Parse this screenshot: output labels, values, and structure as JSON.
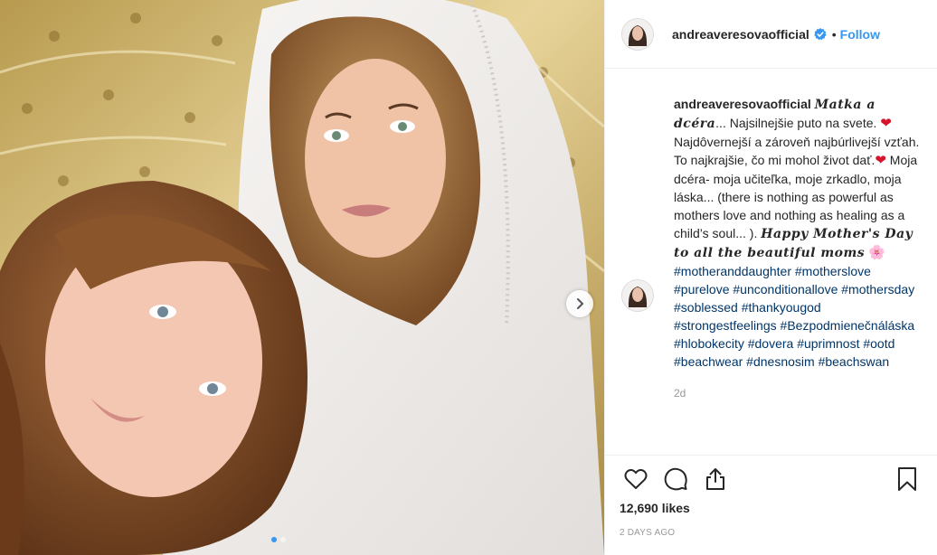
{
  "post": {
    "username": "andreaveresovaofficial",
    "separator": "•",
    "follow_label": "Follow",
    "verified": true,
    "caption_user": "andreaveresovaofficial",
    "caption_script_1": "𝑴𝒂𝒕𝒌𝒂 𝒂 𝒅𝒄𝒆́𝒓𝒂",
    "caption_text_1": "... Najsilnejšie puto na svete.",
    "emoji_heart": "❤",
    "caption_text_2": "Najdôvernejší a zároveň najbúrlivejší vzťah. To najkrajšie, čo mi mohol život dať.",
    "caption_text_3": " Moja dcéra- moja učiteľka, moje zrkadlo, moja láska... (there is nothing as powerful as mothers love and nothing as healing as a child’s soul... ).",
    "caption_script_2": "𝑯𝒂𝒑𝒑𝒚 𝑴𝒐𝒕𝒉𝒆𝒓'𝒔 𝑫𝒂𝒚 𝒕𝒐 𝒂𝒍𝒍 𝒕𝒉𝒆 𝒃𝒆𝒂𝒖𝒕𝒊𝒇𝒖𝒍 𝒎𝒐𝒎𝒔",
    "emoji_flower": "🌸",
    "hashtags": [
      "#motheranddaughter",
      "#motherslove",
      "#purelove",
      "#unconditionallove",
      "#mothersday",
      "#soblessed",
      "#thankyougod",
      "#strongestfeelings",
      "#Bezpodmienečnáláska",
      "#hlobokecity",
      "#dovera",
      "#uprimnost",
      "#ootd",
      "#beachwear",
      "#dnesnosim",
      "#beachswan"
    ],
    "comment_age": "2d",
    "likes": "12,690 likes",
    "date": "2 DAYS AGO"
  },
  "icons": {
    "like": "heart-outline-icon",
    "comment": "speech-bubble-icon",
    "share": "share-upload-icon",
    "save": "bookmark-icon",
    "next": "chevron-right-icon",
    "verified": "verified-badge-icon"
  },
  "colors": {
    "accent": "#3897f0",
    "hashtag": "#003569",
    "muted": "#999999",
    "text": "#262626"
  }
}
